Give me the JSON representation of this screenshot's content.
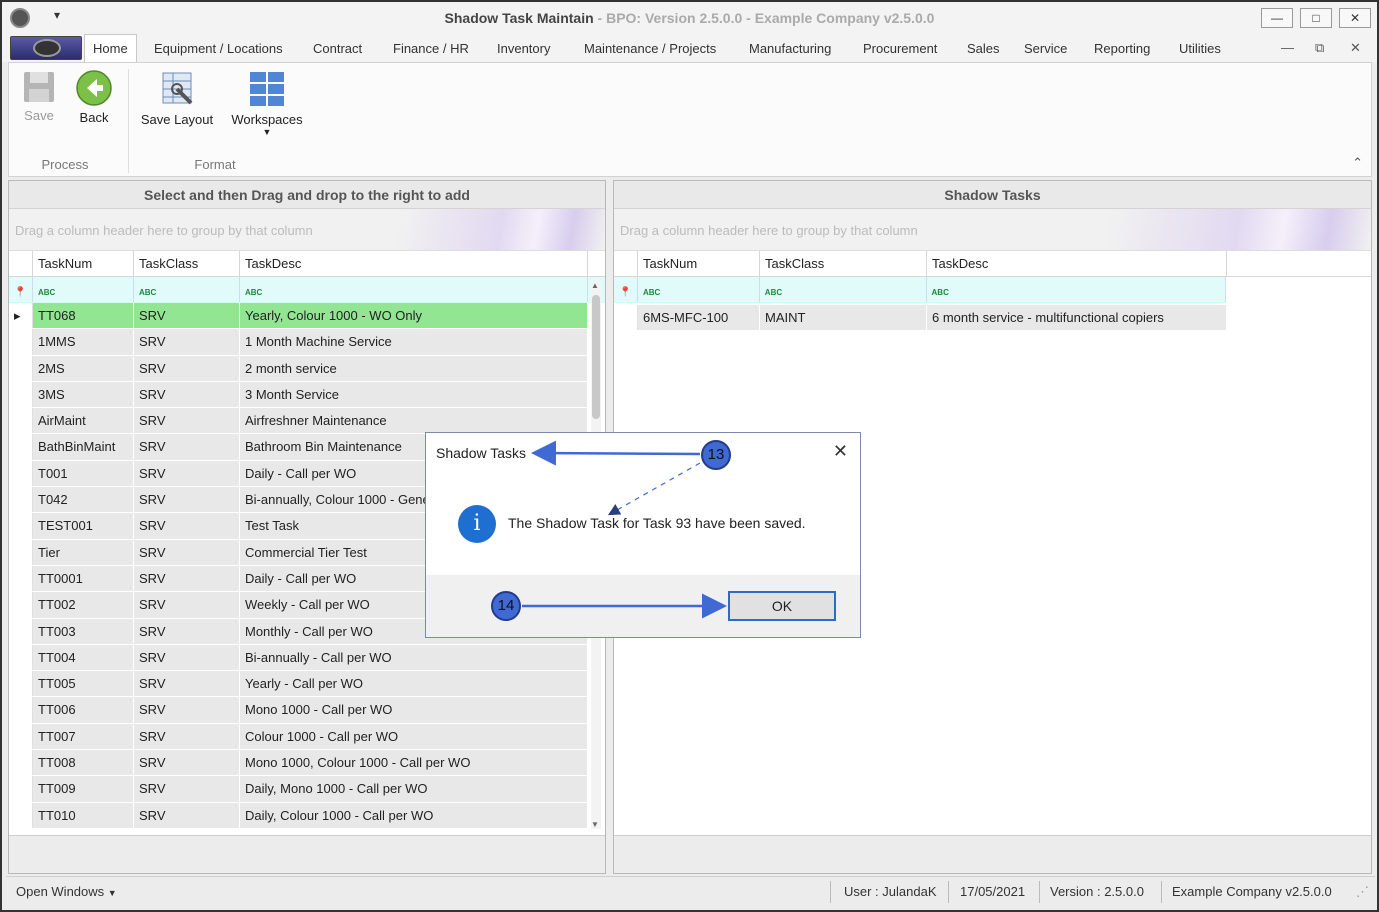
{
  "window": {
    "title": "Shadow Task Maintain",
    "subtitle": " - BPO: Version 2.5.0.0 - Example Company v2.5.0.0",
    "minimize": "—",
    "maximize": "□",
    "close": "✕"
  },
  "menu": {
    "items": [
      "Home",
      "Equipment / Locations",
      "Contract",
      "Finance / HR",
      "Inventory",
      "Maintenance / Projects",
      "Manufacturing",
      "Procurement",
      "Sales",
      "Service",
      "Reporting",
      "Utilities"
    ],
    "mdi_minimize": "—",
    "mdi_restore": "⧉",
    "mdi_close": "✕"
  },
  "ribbon": {
    "save": "Save",
    "back": "Back",
    "save_layout": "Save Layout",
    "workspaces": "Workspaces",
    "group_process": "Process",
    "group_format": "Format"
  },
  "left_panel": {
    "title": "Select and then Drag and drop to the right to add",
    "group_hint": "Drag a column header here to group by that column",
    "columns": [
      "TaskNum",
      "TaskClass",
      "TaskDesc"
    ],
    "rows": [
      [
        "TT068",
        "SRV",
        "Yearly, Colour 1000 - WO Only"
      ],
      [
        "1MMS",
        "SRV",
        "1 Month Machine Service"
      ],
      [
        "2MS",
        "SRV",
        "2 month service"
      ],
      [
        "3MS",
        "SRV",
        "3 Month Service"
      ],
      [
        "AirMaint",
        "SRV",
        "Airfreshner Maintenance"
      ],
      [
        "BathBinMaint",
        "SRV",
        "Bathroom Bin Maintenance"
      ],
      [
        "T001",
        "SRV",
        "Daily - Call per WO"
      ],
      [
        "T042",
        "SRV",
        "Bi-annually, Colour 1000 - Gene"
      ],
      [
        "TEST001",
        "SRV",
        "Test Task"
      ],
      [
        "Tier",
        "SRV",
        "Commercial Tier Test"
      ],
      [
        "TT0001",
        "SRV",
        "Daily - Call per WO"
      ],
      [
        "TT002",
        "SRV",
        "Weekly - Call per WO"
      ],
      [
        "TT003",
        "SRV",
        " Monthly - Call per WO"
      ],
      [
        "TT004",
        "SRV",
        "Bi-annually - Call per WO"
      ],
      [
        "TT005",
        "SRV",
        "Yearly - Call per WO"
      ],
      [
        "TT006",
        "SRV",
        "Mono 1000 - Call per WO"
      ],
      [
        "TT007",
        "SRV",
        "Colour 1000 - Call per WO"
      ],
      [
        "TT008",
        "SRV",
        "Mono 1000, Colour 1000 - Call per WO"
      ],
      [
        "TT009",
        "SRV",
        "Daily, Mono 1000 - Call per WO"
      ],
      [
        "TT010",
        "SRV",
        "Daily, Colour 1000 - Call per WO"
      ]
    ]
  },
  "right_panel": {
    "title": "Shadow Tasks",
    "group_hint": "Drag a column header here to group by that column",
    "columns": [
      "TaskNum",
      "TaskClass",
      "TaskDesc"
    ],
    "rows": [
      [
        "6MS-MFC-100",
        "MAINT",
        "6 month service - multifunctional copiers"
      ]
    ]
  },
  "status": {
    "open_windows": "Open Windows",
    "user": "User : JulandaK",
    "date": "17/05/2021",
    "version": "Version : 2.5.0.0",
    "company": "Example Company v2.5.0.0"
  },
  "dialog": {
    "title": "Shadow Tasks",
    "message": "The Shadow Task for Task 93 have been saved.",
    "ok": "OK",
    "close": "✕",
    "icon": "i"
  },
  "annotations": {
    "step13": "13",
    "step14": "14"
  },
  "colors": {
    "selected_row": "#92e692",
    "annotation": "#3f6ad4",
    "info_icon": "#1e6fd0"
  }
}
